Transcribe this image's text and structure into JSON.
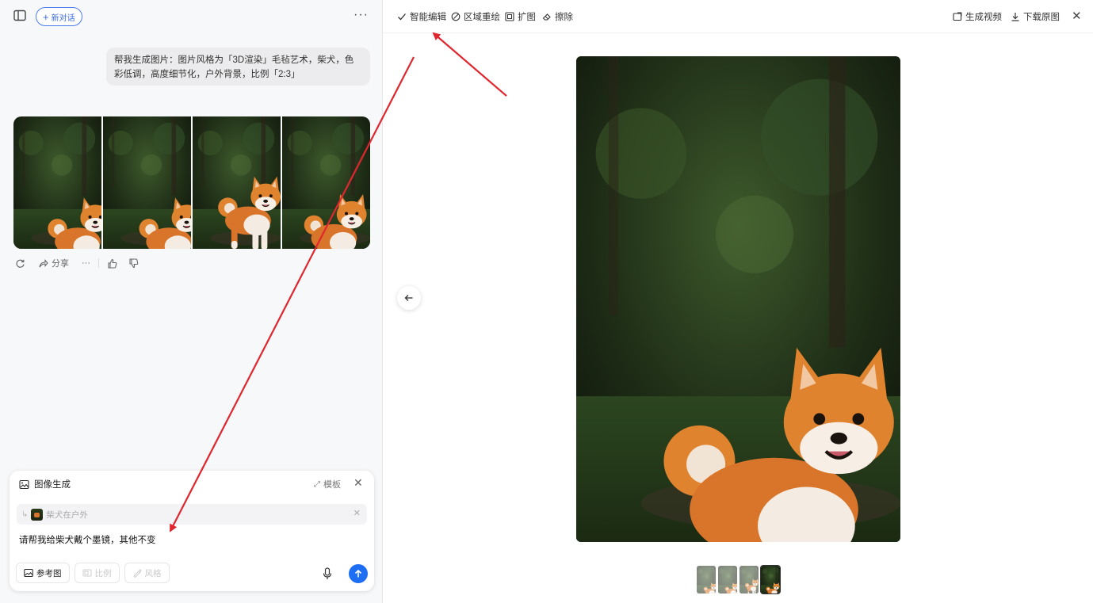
{
  "left": {
    "new_chat_label": "新对话",
    "user_message": "帮我生成图片：图片风格为「3D渲染」毛毡艺术，柴犬，色彩低调，高度细节化，户外背景，比例「2:3」",
    "actions": {
      "share_label": "分享"
    },
    "input_card": {
      "title": "图像生成",
      "template_label": "模板",
      "reference_caption": "柴犬在户外",
      "prompt_value": "请帮我给柴犬戴个墨镜，其他不变",
      "chips": {
        "reference": "参考图",
        "ratio": "比例",
        "style": "风格"
      }
    }
  },
  "toolbar": {
    "smart_edit": "智能编辑",
    "region_redraw": "区域重绘",
    "expand": "扩图",
    "erase": "擦除",
    "generate_video": "生成视频",
    "download": "下载原图"
  },
  "colors": {
    "accent": "#1d6ef2",
    "annotation": "#e0262e"
  },
  "icons": [
    "sidebar-icon",
    "plus-icon",
    "more-icon",
    "refresh-icon",
    "share-icon",
    "thumbs-up-icon",
    "thumbs-down-icon",
    "image-icon",
    "expand-icon",
    "close-icon",
    "mic-icon",
    "send-arrow-icon",
    "check-icon",
    "brush-icon",
    "crop-icon",
    "eraser-icon",
    "video-icon",
    "download-icon",
    "back-arrow-icon"
  ],
  "thumbnails": {
    "count": 4,
    "active_index": 3
  }
}
